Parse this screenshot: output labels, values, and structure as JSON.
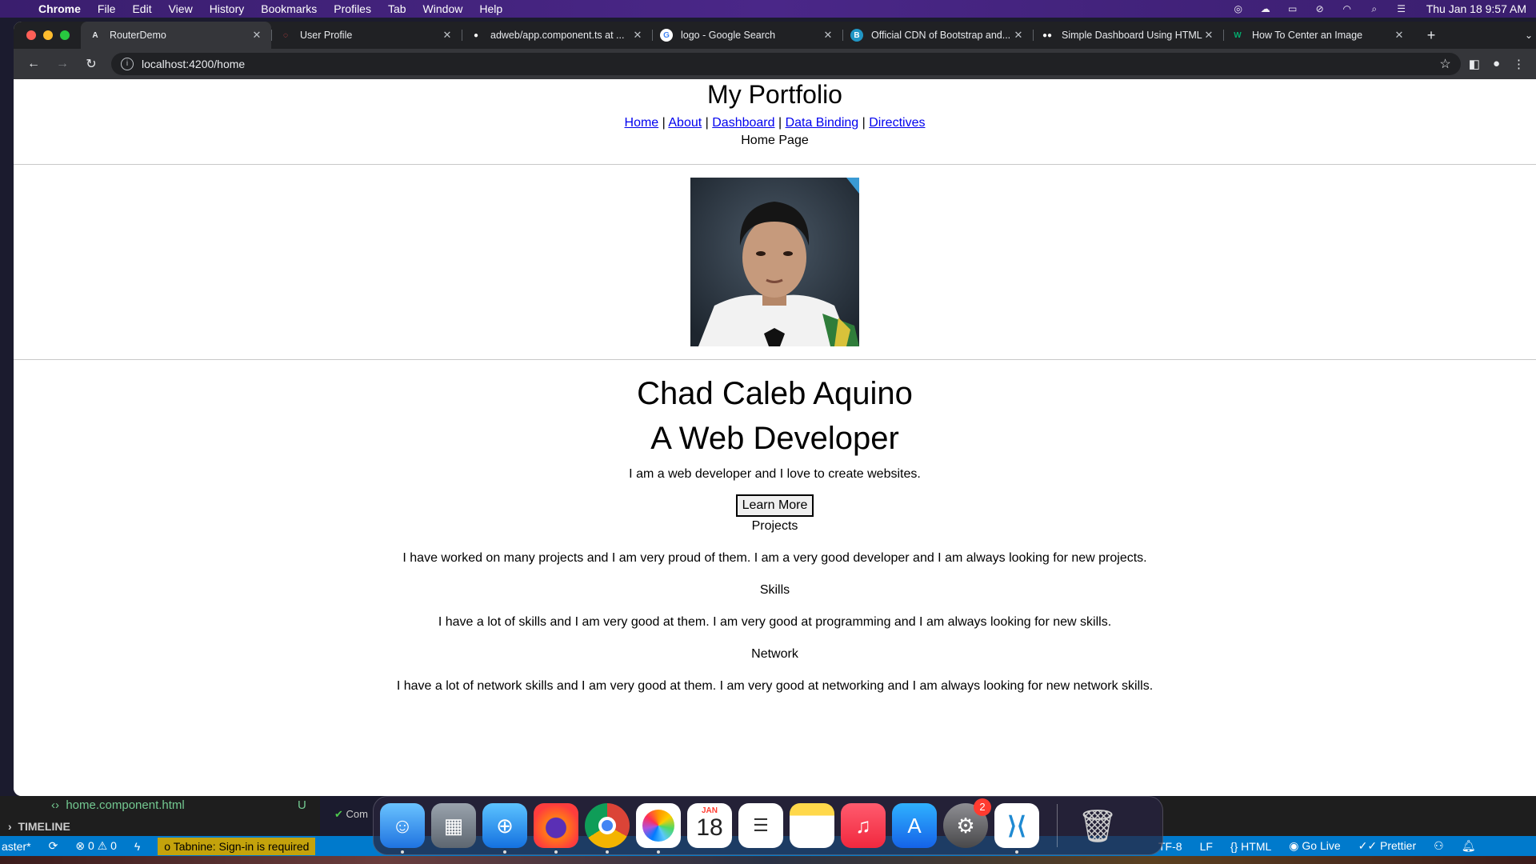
{
  "menubar": {
    "app": "Chrome",
    "items": [
      "File",
      "Edit",
      "View",
      "History",
      "Bookmarks",
      "Profiles",
      "Tab",
      "Window",
      "Help"
    ],
    "clock": "Thu Jan 18  9:57 AM"
  },
  "browser": {
    "tabs": [
      {
        "title": "RouterDemo",
        "favicon": "A",
        "fav_color": "#e8eaed",
        "fav_bg": "transparent"
      },
      {
        "title": "User Profile",
        "favicon": "◌",
        "fav_color": "#ff4d4d",
        "fav_bg": "transparent"
      },
      {
        "title": "adweb/app.component.ts at ...",
        "favicon": "●",
        "fav_color": "#ffffff",
        "fav_bg": "transparent"
      },
      {
        "title": "logo - Google Search",
        "favicon": "G",
        "fav_color": "#4285f4",
        "fav_bg": "#ffffff"
      },
      {
        "title": "Official CDN of Bootstrap and...",
        "favicon": "B",
        "fav_color": "#ffffff",
        "fav_bg": "#2196c4"
      },
      {
        "title": "Simple Dashboard Using HTML...",
        "favicon": "●●",
        "fav_color": "#ffffff",
        "fav_bg": "transparent"
      },
      {
        "title": "How To Center an Image",
        "favicon": "W",
        "fav_color": "#04aa6d",
        "fav_bg": "transparent"
      }
    ],
    "url": "localhost:4200/home"
  },
  "page": {
    "site_title": "My Portfolio",
    "nav": [
      "Home",
      "About",
      "Dashboard",
      "Data Binding",
      "Directives"
    ],
    "page_label": "Home Page",
    "name": "Chad Caleb Aquino",
    "role": "A Web Developer",
    "intro": "I am a web developer and I love to create websites.",
    "learn_more": "Learn More",
    "sections": [
      {
        "title": "Projects",
        "text": "I have worked on many projects and I am very proud of them. I am a very good developer and I am always looking for new projects."
      },
      {
        "title": "Skills",
        "text": "I have a lot of skills and I am very good at them. I am very good at programming and I am always looking for new skills."
      },
      {
        "title": "Network",
        "text": "I have a lot of network skills and I am very good at them. I am very good at networking and I am always looking for new network skills."
      }
    ]
  },
  "vscode": {
    "file": "home.component.html",
    "file_status": "U",
    "timeline": "TIMELINE",
    "com": "Com",
    "branch": "aster*",
    "errors": "0",
    "warnings": "0",
    "tabnine": "Tabnine: Sign-in is required",
    "encoding": "TF-8",
    "eol": "LF",
    "language": "HTML",
    "golive": "Go Live",
    "prettier": "Prettier"
  },
  "dock": {
    "calendar_month": "JAN",
    "calendar_day": "18",
    "settings_badge": "2"
  }
}
